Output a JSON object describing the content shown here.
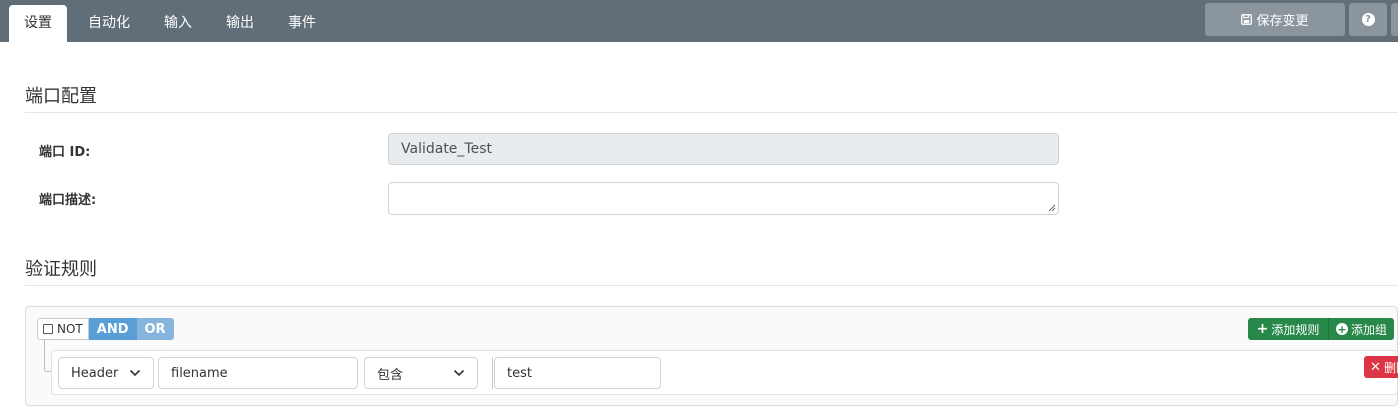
{
  "tabs": [
    {
      "label": "设置",
      "active": true
    },
    {
      "label": "自动化",
      "active": false
    },
    {
      "label": "输入",
      "active": false
    },
    {
      "label": "输出",
      "active": false
    },
    {
      "label": "事件",
      "active": false
    }
  ],
  "toolbar": {
    "save_label": "保存变更",
    "save_icon": "floppy-disk-icon",
    "help_label": "?"
  },
  "port_config": {
    "title": "端口配置",
    "id_label": "端口 ID:",
    "id_value": "Validate_Test",
    "desc_label": "端口描述:",
    "desc_value": ""
  },
  "validation": {
    "title": "验证规则",
    "not_label": "NOT",
    "and_label": "AND",
    "or_label": "OR",
    "add_rule_label": "添加规则",
    "add_group_label": "添加组",
    "rule": {
      "field_type": "Header",
      "field_name": "filename",
      "operator": "包含",
      "value": "test",
      "delete_label": "删除"
    }
  },
  "colors": {
    "topbar": "#616e78",
    "button_gray": "#8b959e",
    "and_blue": "#5a9ed6",
    "success_green": "#28884a",
    "danger_red": "#dc3545"
  }
}
